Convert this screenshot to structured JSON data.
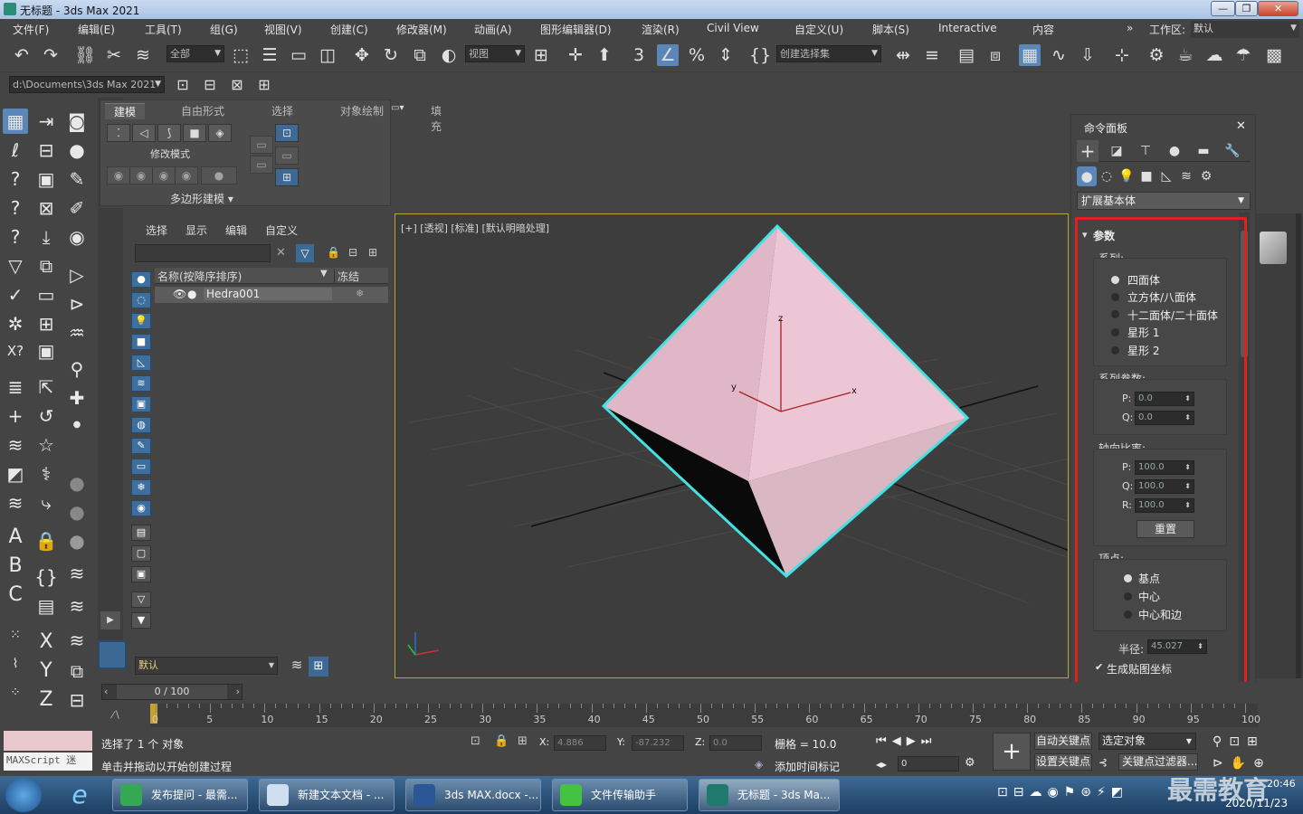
{
  "window": {
    "title": "无标题 - 3ds Max 2021",
    "minimize": "—",
    "maximize": "❐",
    "close": "✕"
  },
  "menu": {
    "items": [
      "文件(F)",
      "编辑(E)",
      "工具(T)",
      "组(G)",
      "视图(V)",
      "创建(C)",
      "修改器(M)",
      "动画(A)",
      "图形编辑器(D)",
      "渲染(R)",
      "Civil View",
      "自定义(U)",
      "脚本(S)",
      "Interactive",
      "内容"
    ],
    "workspace_label": "工作区:",
    "workspace_value": "默认"
  },
  "toolbar": {
    "filter_dropdown": "全部",
    "refcoord_dropdown": "视图",
    "selection_set": "创建选择集",
    "project_path": "d:\\Documents\\3ds Max 2021"
  },
  "ribbon": {
    "tabs": [
      "建模",
      "自由形式",
      "选择",
      "对象绘制",
      "填充"
    ],
    "modify_mode": "修改模式",
    "poly_modeling": "多边形建模"
  },
  "explorer": {
    "tabs": [
      "选择",
      "显示",
      "编辑",
      "自定义"
    ],
    "col_name": "名称(按降序排序)",
    "col_freeze": "冻结",
    "rows": [
      {
        "name": "Hedra001"
      }
    ],
    "layer_dropdown": "默认"
  },
  "viewport": {
    "label": "[+] [透视] [标准] [默认明暗处理]",
    "axis_x": "x",
    "axis_y": "y",
    "axis_z": "z"
  },
  "command_panel": {
    "title": "命令面板",
    "category_dropdown": "扩展基本体",
    "rollout_title": "参数",
    "family_label": "系列:",
    "families": [
      "四面体",
      "立方体/八面体",
      "十二面体/二十面体",
      "星形 1",
      "星形 2"
    ],
    "family_selected": 0,
    "family_params_label": "系列参数:",
    "p_label": "P:",
    "p_value": "0.0",
    "q_label": "Q:",
    "q_value": "0.0",
    "axis_scale_label": "轴向比率:",
    "axis_p_label": "P:",
    "axis_p": "100.0",
    "axis_q_label": "Q:",
    "axis_q": "100.0",
    "axis_r_label": "R:",
    "axis_r": "100.0",
    "reset_button": "重置",
    "vertices_label": "顶点:",
    "vertices": [
      "基点",
      "中心",
      "中心和边"
    ],
    "vertex_selected": 0,
    "radius_label": "半径:",
    "radius_value": "45.027",
    "gen_mapping": "生成贴图坐标",
    "highlight_color": "#e02020"
  },
  "timeline": {
    "frame_display": "0 / 100",
    "ticks": [
      "0",
      "5",
      "10",
      "15",
      "20",
      "25",
      "30",
      "35",
      "40",
      "45",
      "50",
      "55",
      "60",
      "65",
      "70",
      "75",
      "80",
      "85",
      "90",
      "95",
      "100"
    ]
  },
  "status": {
    "selected": "选择了 1 个 对象",
    "hint": "单击并拖动以开始创建过程",
    "maxscript": "MAXScript 迷",
    "x_label": "X:",
    "x_value": "4.886",
    "y_label": "Y:",
    "y_value": "-87.232",
    "z_label": "Z:",
    "z_value": "0.0",
    "grid": "栅格 = 10.0",
    "add_time_tag": "添加时间标记",
    "auto_key": "自动关键点",
    "set_key": "设置关键点",
    "selected_object": "选定对象",
    "key_filters": "关键点过滤器...",
    "frame_field": "0"
  },
  "taskbar": {
    "items": [
      "发布提问 - 最需...",
      "新建文本文档 - ...",
      "3ds MAX.docx -...",
      "文件传输助手",
      "无标题 - 3ds Ma..."
    ],
    "time": "20:46",
    "date": "2020/11/23",
    "watermark": "最需教育"
  }
}
